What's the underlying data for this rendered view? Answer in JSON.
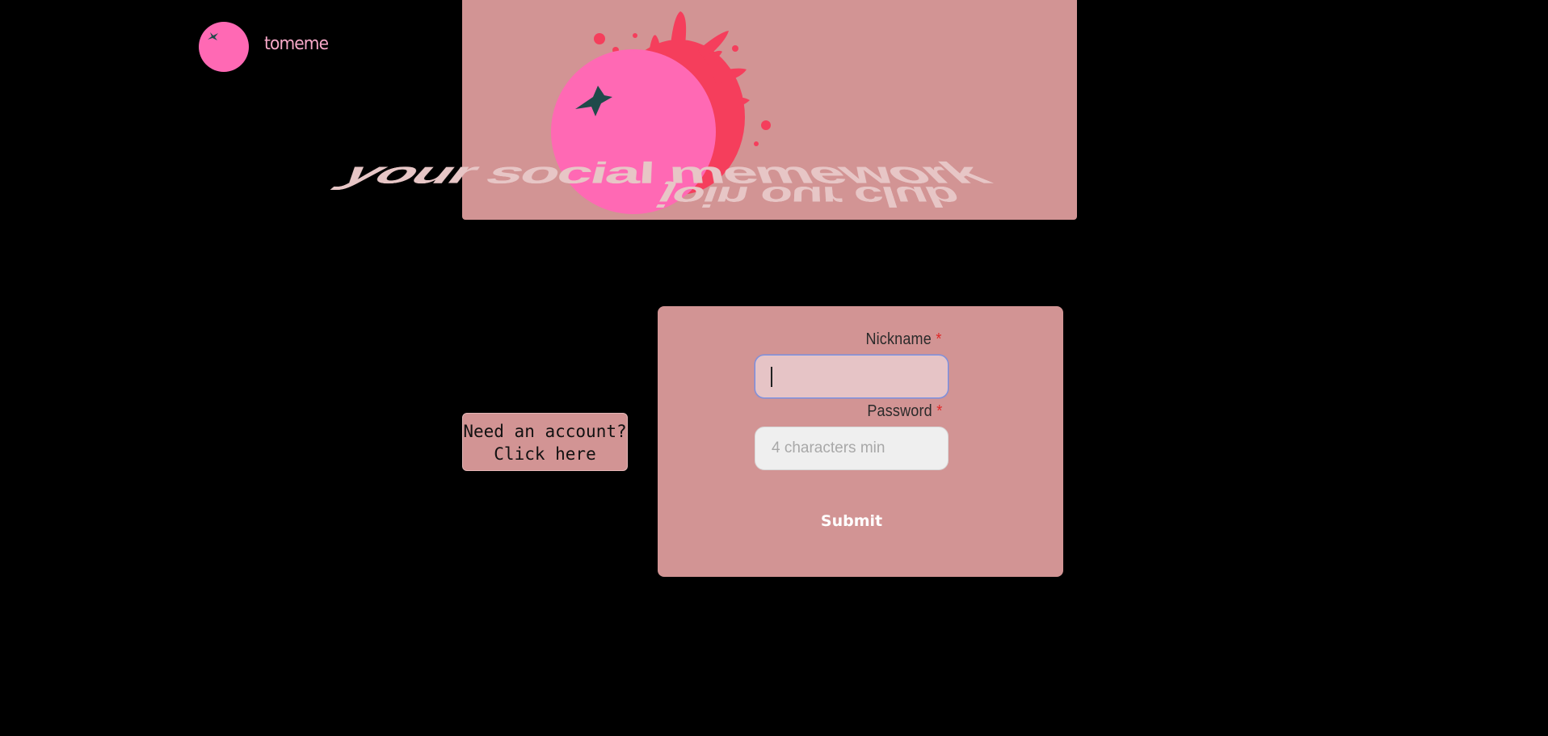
{
  "header": {
    "brand": "tomeme",
    "logo_icon": "tomato-icon"
  },
  "hero": {
    "tagline_1": "your social memework",
    "tagline_2": "join our club",
    "art_icon": "tomato-splash-illustration"
  },
  "side": {
    "account_line_1": "Need an account?",
    "account_line_2": "Click here"
  },
  "login_form": {
    "nickname_label": "Nickname",
    "password_label": "Password",
    "required_marker": "*",
    "nickname_value": "",
    "password_placeholder": "4 characters min",
    "submit_label": "Submit"
  },
  "colors": {
    "background": "#000000",
    "panel": "#D29494",
    "tomato": "#FF69B4",
    "splash": "#F53E5C",
    "leaf": "#1F4A4A",
    "tagline": "#E7C6C6",
    "brand_text": "#F7A8C8",
    "required": "#E02828",
    "focus_ring": "#6F8EE8"
  }
}
